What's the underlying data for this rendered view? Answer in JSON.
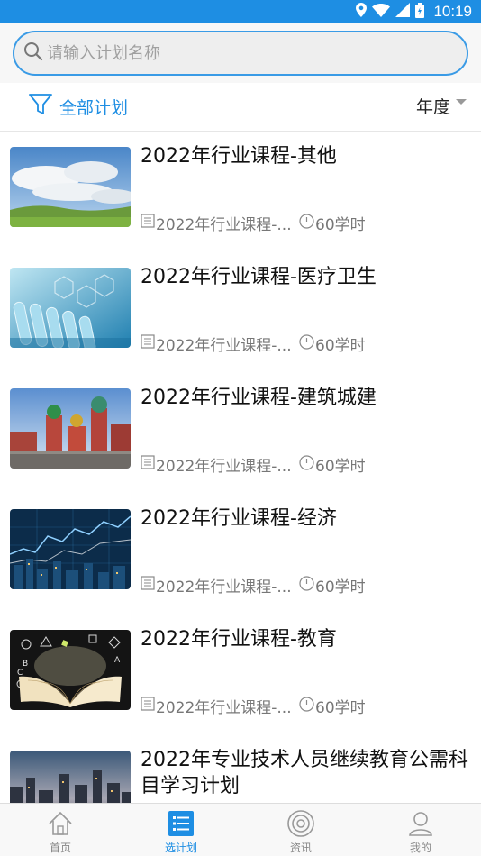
{
  "status_bar": {
    "time": "10:19"
  },
  "search": {
    "placeholder": "请输入计划名称"
  },
  "filter": {
    "all_plans_label": "全部计划",
    "year_label": "年度"
  },
  "plans": [
    {
      "title": "2022年行业课程-其他",
      "subject": "2022年行业课程-...",
      "hours": "60学时",
      "image": "sky-grassland"
    },
    {
      "title": "2022年行业课程-医疗卫生",
      "subject": "2022年行业课程-...",
      "hours": "60学时",
      "image": "test-tubes"
    },
    {
      "title": "2022年行业课程-建筑城建",
      "subject": "2022年行业课程-...",
      "hours": "60学时",
      "image": "onion-dome-buildings"
    },
    {
      "title": "2022年行业课程-经济",
      "subject": "2022年行业课程-...",
      "hours": "60学时",
      "image": "city-chart-lines"
    },
    {
      "title": "2022年行业课程-教育",
      "subject": "2022年行业课程-...",
      "hours": "60学时",
      "image": "open-book"
    },
    {
      "title": "2022年专业技术人员继续教育公需科目学习计划",
      "image": "city-skyline"
    }
  ],
  "tabbar": {
    "tabs": [
      {
        "label": "首页",
        "icon": "home-icon"
      },
      {
        "label": "选计划",
        "icon": "list-icon",
        "active": true
      },
      {
        "label": "资讯",
        "icon": "news-icon"
      },
      {
        "label": "我的",
        "icon": "user-icon"
      }
    ]
  },
  "colors": {
    "accent": "#1e8ee3",
    "status_bar": "#1e8ee3"
  }
}
